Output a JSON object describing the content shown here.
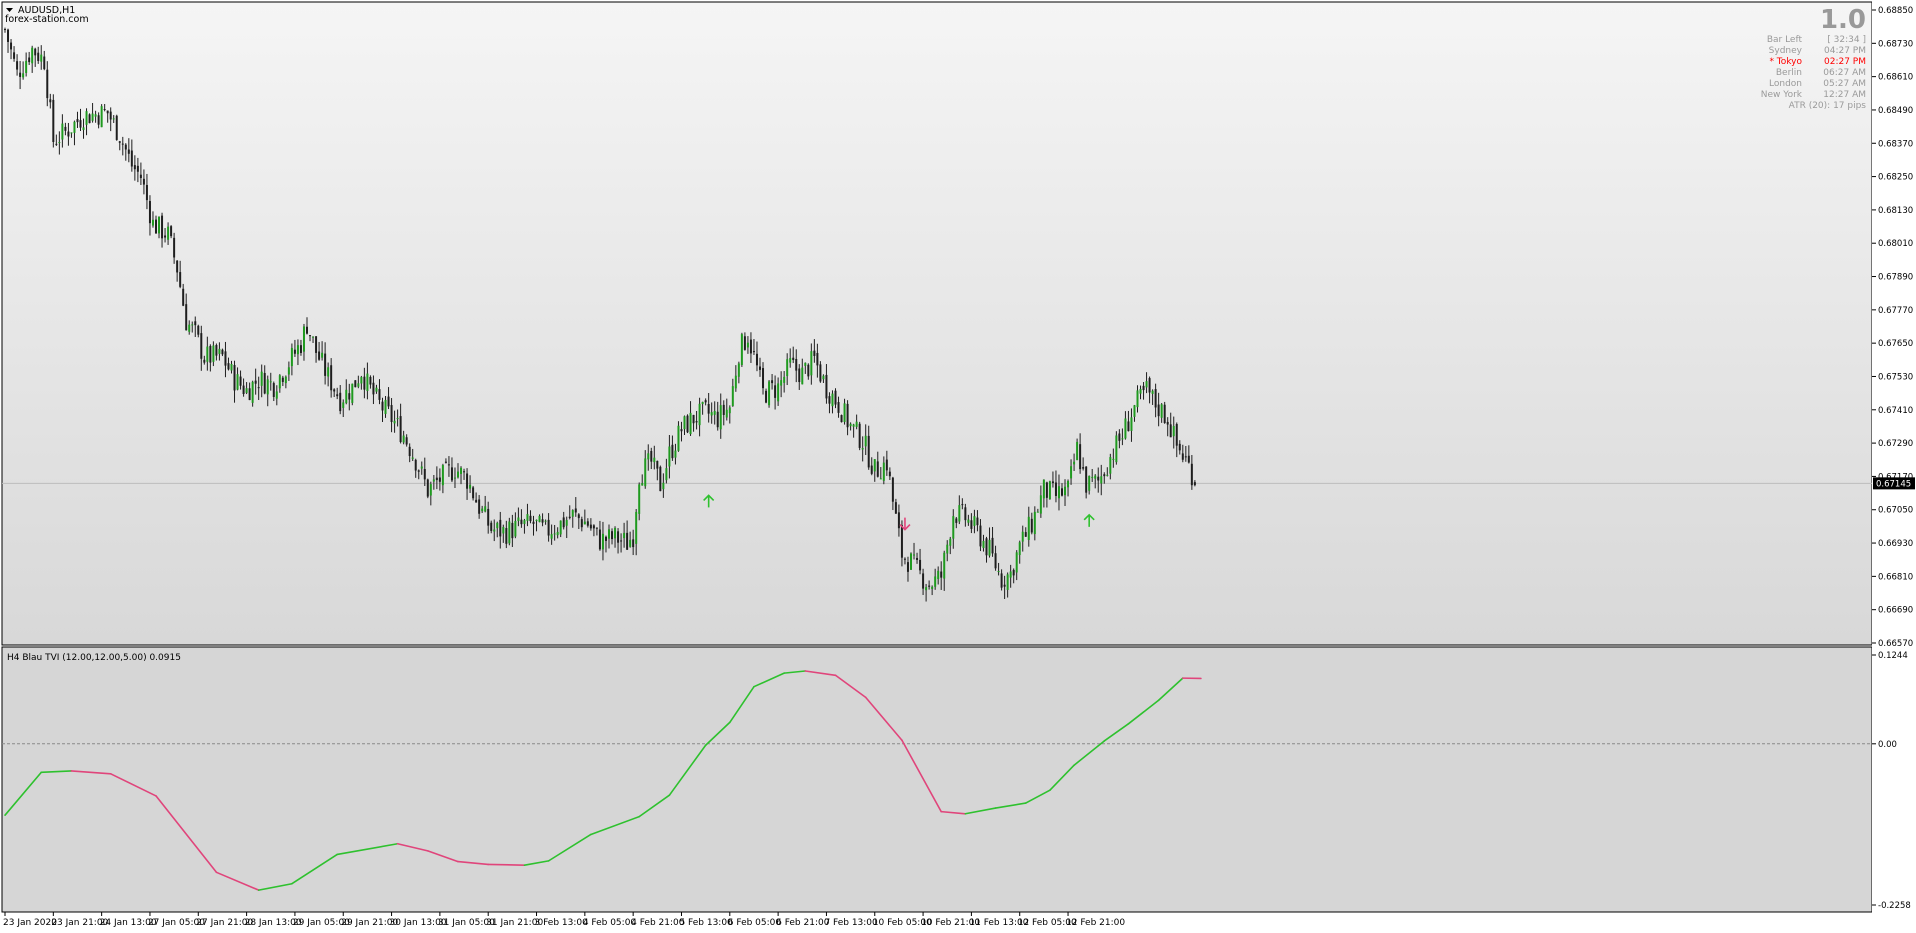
{
  "window": {
    "symbol_title": "AUDUSD,H1",
    "watermark": "forex-station.com"
  },
  "info_panel": {
    "spread": "1.0",
    "rows": [
      {
        "label": "Bar Left",
        "value": "[ 32:34 ]",
        "highlight": false
      },
      {
        "label": "Sydney",
        "value": "04:27 PM",
        "highlight": false
      },
      {
        "label": "* Tokyo",
        "value": "02:27 PM",
        "highlight": true
      },
      {
        "label": "Berlin",
        "value": "06:27 AM",
        "highlight": false
      },
      {
        "label": "London",
        "value": "05:27 AM",
        "highlight": false
      },
      {
        "label": "New York",
        "value": "12:27 AM",
        "highlight": false
      },
      {
        "label": "ATR (20): 17 pips",
        "value": "",
        "highlight": false
      }
    ]
  },
  "indicator": {
    "label": "H4 Blau TVI (12.00,12.00,5.00) 0.0915"
  },
  "colors": {
    "bull": "#1f9a1f",
    "bear": "#1e1e1e",
    "tvi_up": "#2ec12e",
    "tvi_down": "#e0457b",
    "arrow_up": "#2ec12e",
    "arrow_down": "#e0457b",
    "tokyo": "#ff0000",
    "price_tag": "#000000"
  },
  "chart_data": [
    {
      "type": "candlestick",
      "symbol": "AUDUSD",
      "timeframe": "H1",
      "ylim": [
        0.6657,
        0.6885
      ],
      "y_ticks": [
        "0.68850",
        "0.68730",
        "0.68610",
        "0.68490",
        "0.68370",
        "0.68250",
        "0.68130",
        "0.68010",
        "0.67890",
        "0.67770",
        "0.67650",
        "0.67530",
        "0.67410",
        "0.67290",
        "0.67170",
        "0.67050",
        "0.66930",
        "0.66810",
        "0.66690",
        "0.66570"
      ],
      "current_price": "0.67145",
      "x_tick_labels": [
        "23 Jan 2020",
        "23 Jan 21:00",
        "24 Jan 13:00",
        "27 Jan 05:00",
        "27 Jan 21:00",
        "28 Jan 13:00",
        "29 Jan 05:00",
        "29 Jan 21:00",
        "30 Jan 13:00",
        "31 Jan 05:00",
        "31 Jan 21:00",
        "3 Feb 13:00",
        "4 Feb 05:00",
        "4 Feb 21:00",
        "5 Feb 13:00",
        "6 Feb 05:00",
        "6 Feb 21:00",
        "7 Feb 13:00",
        "10 Feb 05:00",
        "10 Feb 21:00",
        "11 Feb 13:00",
        "12 Feb 05:00",
        "12 Feb 21:00"
      ],
      "bars_between_ticks": 16,
      "close_path": [
        [
          0,
          0.6878
        ],
        [
          4,
          0.6862
        ],
        [
          9,
          0.6871
        ],
        [
          13,
          0.6867
        ],
        [
          16,
          0.6838
        ],
        [
          20,
          0.6841
        ],
        [
          26,
          0.6847
        ],
        [
          34,
          0.6848
        ],
        [
          38,
          0.684
        ],
        [
          42,
          0.6829
        ],
        [
          45,
          0.6825
        ],
        [
          49,
          0.6808
        ],
        [
          54,
          0.6804
        ],
        [
          57,
          0.6792
        ],
        [
          60,
          0.6773
        ],
        [
          63,
          0.6768
        ],
        [
          66,
          0.676
        ],
        [
          72,
          0.676
        ],
        [
          76,
          0.6752
        ],
        [
          80,
          0.6748
        ],
        [
          84,
          0.6752
        ],
        [
          89,
          0.675
        ],
        [
          94,
          0.6758
        ],
        [
          98,
          0.6765
        ],
        [
          100,
          0.6772
        ],
        [
          103,
          0.6762
        ],
        [
          106,
          0.6755
        ],
        [
          111,
          0.6745
        ],
        [
          115,
          0.6749
        ],
        [
          118,
          0.6755
        ],
        [
          120,
          0.675
        ],
        [
          124,
          0.6743
        ],
        [
          128,
          0.6738
        ],
        [
          132,
          0.6732
        ],
        [
          136,
          0.6723
        ],
        [
          140,
          0.6712
        ],
        [
          144,
          0.6716
        ],
        [
          149,
          0.672
        ],
        [
          153,
          0.6716
        ],
        [
          157,
          0.6706
        ],
        [
          161,
          0.6698
        ],
        [
          166,
          0.6697
        ],
        [
          170,
          0.6699
        ],
        [
          175,
          0.67
        ],
        [
          179,
          0.6697
        ],
        [
          184,
          0.67
        ],
        [
          188,
          0.6703
        ],
        [
          193,
          0.67
        ],
        [
          197,
          0.6694
        ],
        [
          202,
          0.6695
        ],
        [
          206,
          0.6693
        ],
        [
          208,
          0.6696
        ],
        [
          210,
          0.6718
        ],
        [
          214,
          0.6722
        ],
        [
          217,
          0.6714
        ],
        [
          220,
          0.6725
        ],
        [
          224,
          0.6734
        ],
        [
          228,
          0.6738
        ],
        [
          232,
          0.674
        ],
        [
          236,
          0.6738
        ],
        [
          240,
          0.6742
        ],
        [
          243,
          0.6762
        ],
        [
          246,
          0.6768
        ],
        [
          248,
          0.676
        ],
        [
          251,
          0.6747
        ],
        [
          256,
          0.6749
        ],
        [
          260,
          0.6757
        ],
        [
          264,
          0.6754
        ],
        [
          268,
          0.6759
        ],
        [
          272,
          0.6749
        ],
        [
          276,
          0.6743
        ],
        [
          280,
          0.6735
        ],
        [
          284,
          0.673
        ],
        [
          288,
          0.6719
        ],
        [
          292,
          0.6722
        ],
        [
          294,
          0.6708
        ],
        [
          297,
          0.6689
        ],
        [
          300,
          0.6686
        ],
        [
          302,
          0.6683
        ],
        [
          306,
          0.6678
        ],
        [
          310,
          0.6681
        ],
        [
          314,
          0.6704
        ],
        [
          318,
          0.6702
        ],
        [
          322,
          0.6697
        ],
        [
          326,
          0.669
        ],
        [
          330,
          0.668
        ],
        [
          333,
          0.6682
        ],
        [
          336,
          0.6692
        ],
        [
          340,
          0.67
        ],
        [
          344,
          0.6712
        ],
        [
          348,
          0.671
        ],
        [
          352,
          0.6712
        ],
        [
          355,
          0.6727
        ],
        [
          358,
          0.6714
        ],
        [
          362,
          0.6715
        ],
        [
          366,
          0.6724
        ],
        [
          370,
          0.6732
        ],
        [
          374,
          0.6742
        ],
        [
          378,
          0.6748
        ],
        [
          381,
          0.6743
        ],
        [
          385,
          0.6738
        ],
        [
          388,
          0.6728
        ],
        [
          391,
          0.6723
        ],
        [
          394,
          0.6716
        ]
      ]
    },
    {
      "type": "line",
      "name": "H4 Blau TVI (12.00,12.00,5.00)",
      "last_value": "0.0915",
      "ylim": [
        -0.2258,
        0.1244
      ],
      "y_tick_labels": [
        "0.1244",
        "0.00",
        "-0.2258"
      ],
      "zero_line": true,
      "points": [
        [
          0,
          -0.1
        ],
        [
          12,
          -0.04
        ],
        [
          22,
          -0.038
        ],
        [
          35,
          -0.042
        ],
        [
          50,
          -0.073
        ],
        [
          70,
          -0.18
        ],
        [
          84,
          -0.205
        ],
        [
          95,
          -0.196
        ],
        [
          110,
          -0.155
        ],
        [
          130,
          -0.14
        ],
        [
          140,
          -0.15
        ],
        [
          150,
          -0.165
        ],
        [
          160,
          -0.169
        ],
        [
          172,
          -0.17
        ],
        [
          180,
          -0.164
        ],
        [
          194,
          -0.127
        ],
        [
          210,
          -0.102
        ],
        [
          220,
          -0.072
        ],
        [
          232,
          -0.002
        ],
        [
          240,
          0.03
        ],
        [
          248,
          0.08
        ],
        [
          258,
          0.099
        ],
        [
          265,
          0.102
        ],
        [
          275,
          0.096
        ],
        [
          285,
          0.065
        ],
        [
          297,
          0.005
        ],
        [
          310,
          -0.095
        ],
        [
          318,
          -0.098
        ],
        [
          328,
          -0.09
        ],
        [
          338,
          -0.083
        ],
        [
          346,
          -0.065
        ],
        [
          354,
          -0.03
        ],
        [
          364,
          0.004
        ],
        [
          372,
          0.028
        ],
        [
          382,
          0.061
        ],
        [
          390,
          0.092
        ],
        [
          396,
          0.0915
        ]
      ],
      "arrows": [
        {
          "bar": 233,
          "direction": "up",
          "price": 0.6708
        },
        {
          "bar": 298,
          "direction": "down",
          "price": 0.67
        },
        {
          "bar": 359,
          "direction": "up",
          "price": 0.6701
        }
      ]
    }
  ]
}
